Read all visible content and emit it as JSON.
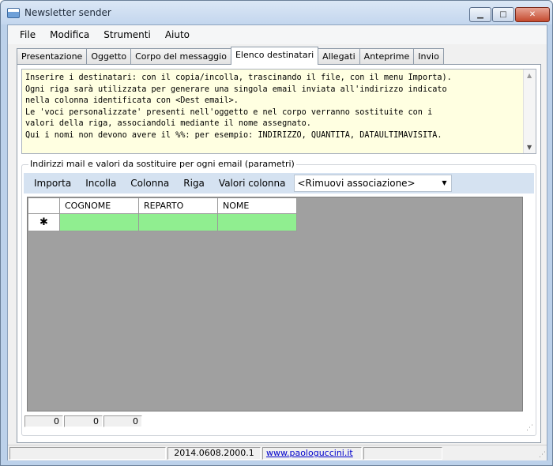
{
  "window": {
    "title": "Newsletter sender",
    "icon": "app-window-icon"
  },
  "titlebar_buttons": {
    "minimize": "▁",
    "maximize": "□",
    "close": "✕"
  },
  "menu": [
    "File",
    "Modifica",
    "Strumenti",
    "Aiuto"
  ],
  "tabs": [
    "Presentazione",
    "Oggetto",
    "Corpo del messaggio",
    "Elenco destinatari",
    "Allegati",
    "Anteprime",
    "Invio"
  ],
  "active_tab": "Elenco destinatari",
  "info_text": "Inserire i destinatari: con il copia/incolla, trascinando il file, con il menu Importa).\nOgni riga sarà utilizzata per generare una singola email inviata all'indirizzo indicato\nnella colonna identificata con <Dest email>.\nLe 'voci personalizzate' presenti nell'oggetto e nel corpo verranno sostituite con i\nvalori della riga, associandoli mediante il nome assegnato.\nQui i nomi non devono avere il %%: per esempio: INDIRIZZO, QUANTITA, DATAULTIMAVISITA.",
  "group_label": "Indirizzi mail e valori da sostituire per ogni email (parametri)",
  "toolbar": {
    "buttons": [
      "Importa",
      "Incolla",
      "Colonna",
      "Riga",
      "Valori colonna"
    ],
    "combo_value": "<Rimuovi associazione>"
  },
  "grid": {
    "columns": [
      "COGNOME",
      "REPARTO",
      "NOME"
    ],
    "new_row_marker": "✱",
    "cell_color": "#90ee90"
  },
  "counters": [
    "0",
    "0",
    "0"
  ],
  "status": {
    "version": "2014.0608.2000.1",
    "link": "www.paologuccini.it"
  }
}
